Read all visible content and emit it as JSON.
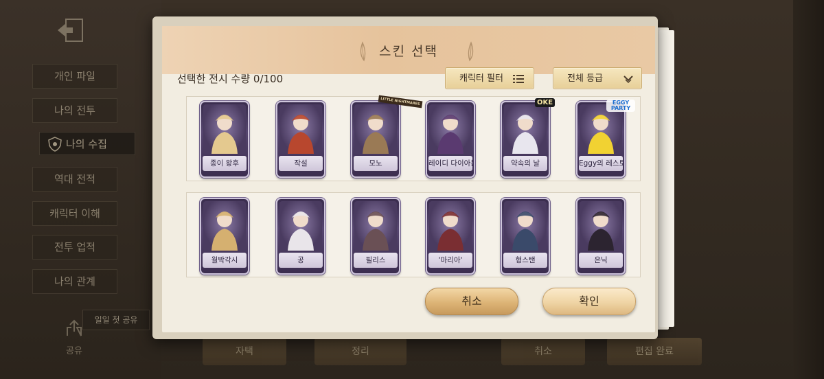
{
  "background": {
    "side_menu": [
      {
        "label": "개인 파일"
      },
      {
        "label": "나의 전투"
      },
      {
        "label": "나의 수집",
        "active": true
      },
      {
        "label": "역대 전적"
      },
      {
        "label": "캐릭터 이해"
      },
      {
        "label": "전투 업적"
      },
      {
        "label": "나의 관계"
      }
    ],
    "share_tag": "일일 첫 공유",
    "share_label": "공유",
    "bottom_buttons": [
      {
        "label": "자택"
      },
      {
        "label": "정리"
      },
      {
        "label": "취소"
      },
      {
        "label": "편집 완료"
      }
    ]
  },
  "dialog": {
    "title": "스킨 선택",
    "count_label": "선택한 전시 수량 0/100",
    "filter_button": "캐릭터 필터",
    "grade_dropdown": "전체 등급",
    "cards_row1": [
      {
        "name": "종이 왕후",
        "art": "#e4c98f"
      },
      {
        "name": "작설",
        "art": "#b8472e"
      },
      {
        "name": "모노",
        "art": "#9a7a55",
        "badge": "LITTLE NIGHTMARES"
      },
      {
        "name": "레이디 다이아몬드",
        "art": "#5a3a70"
      },
      {
        "name": "약속의 날",
        "art": "#e8e6ee",
        "badge": "OKE"
      },
      {
        "name": "Eggy의 레스토 프렌즈",
        "art": "#f1d232",
        "badge": "EGGY PARTY"
      }
    ],
    "cards_row2": [
      {
        "name": "월박각시",
        "art": "#d5b070"
      },
      {
        "name": "공",
        "art": "#e9e5ea"
      },
      {
        "name": "필리스",
        "art": "#6a5055"
      },
      {
        "name": "'마리아'",
        "art": "#7a2e32"
      },
      {
        "name": "형스탠",
        "art": "#3a4a6a"
      },
      {
        "name": "은닉",
        "art": "#2c2430"
      }
    ],
    "cancel_button": "취소",
    "confirm_button": "확인"
  }
}
